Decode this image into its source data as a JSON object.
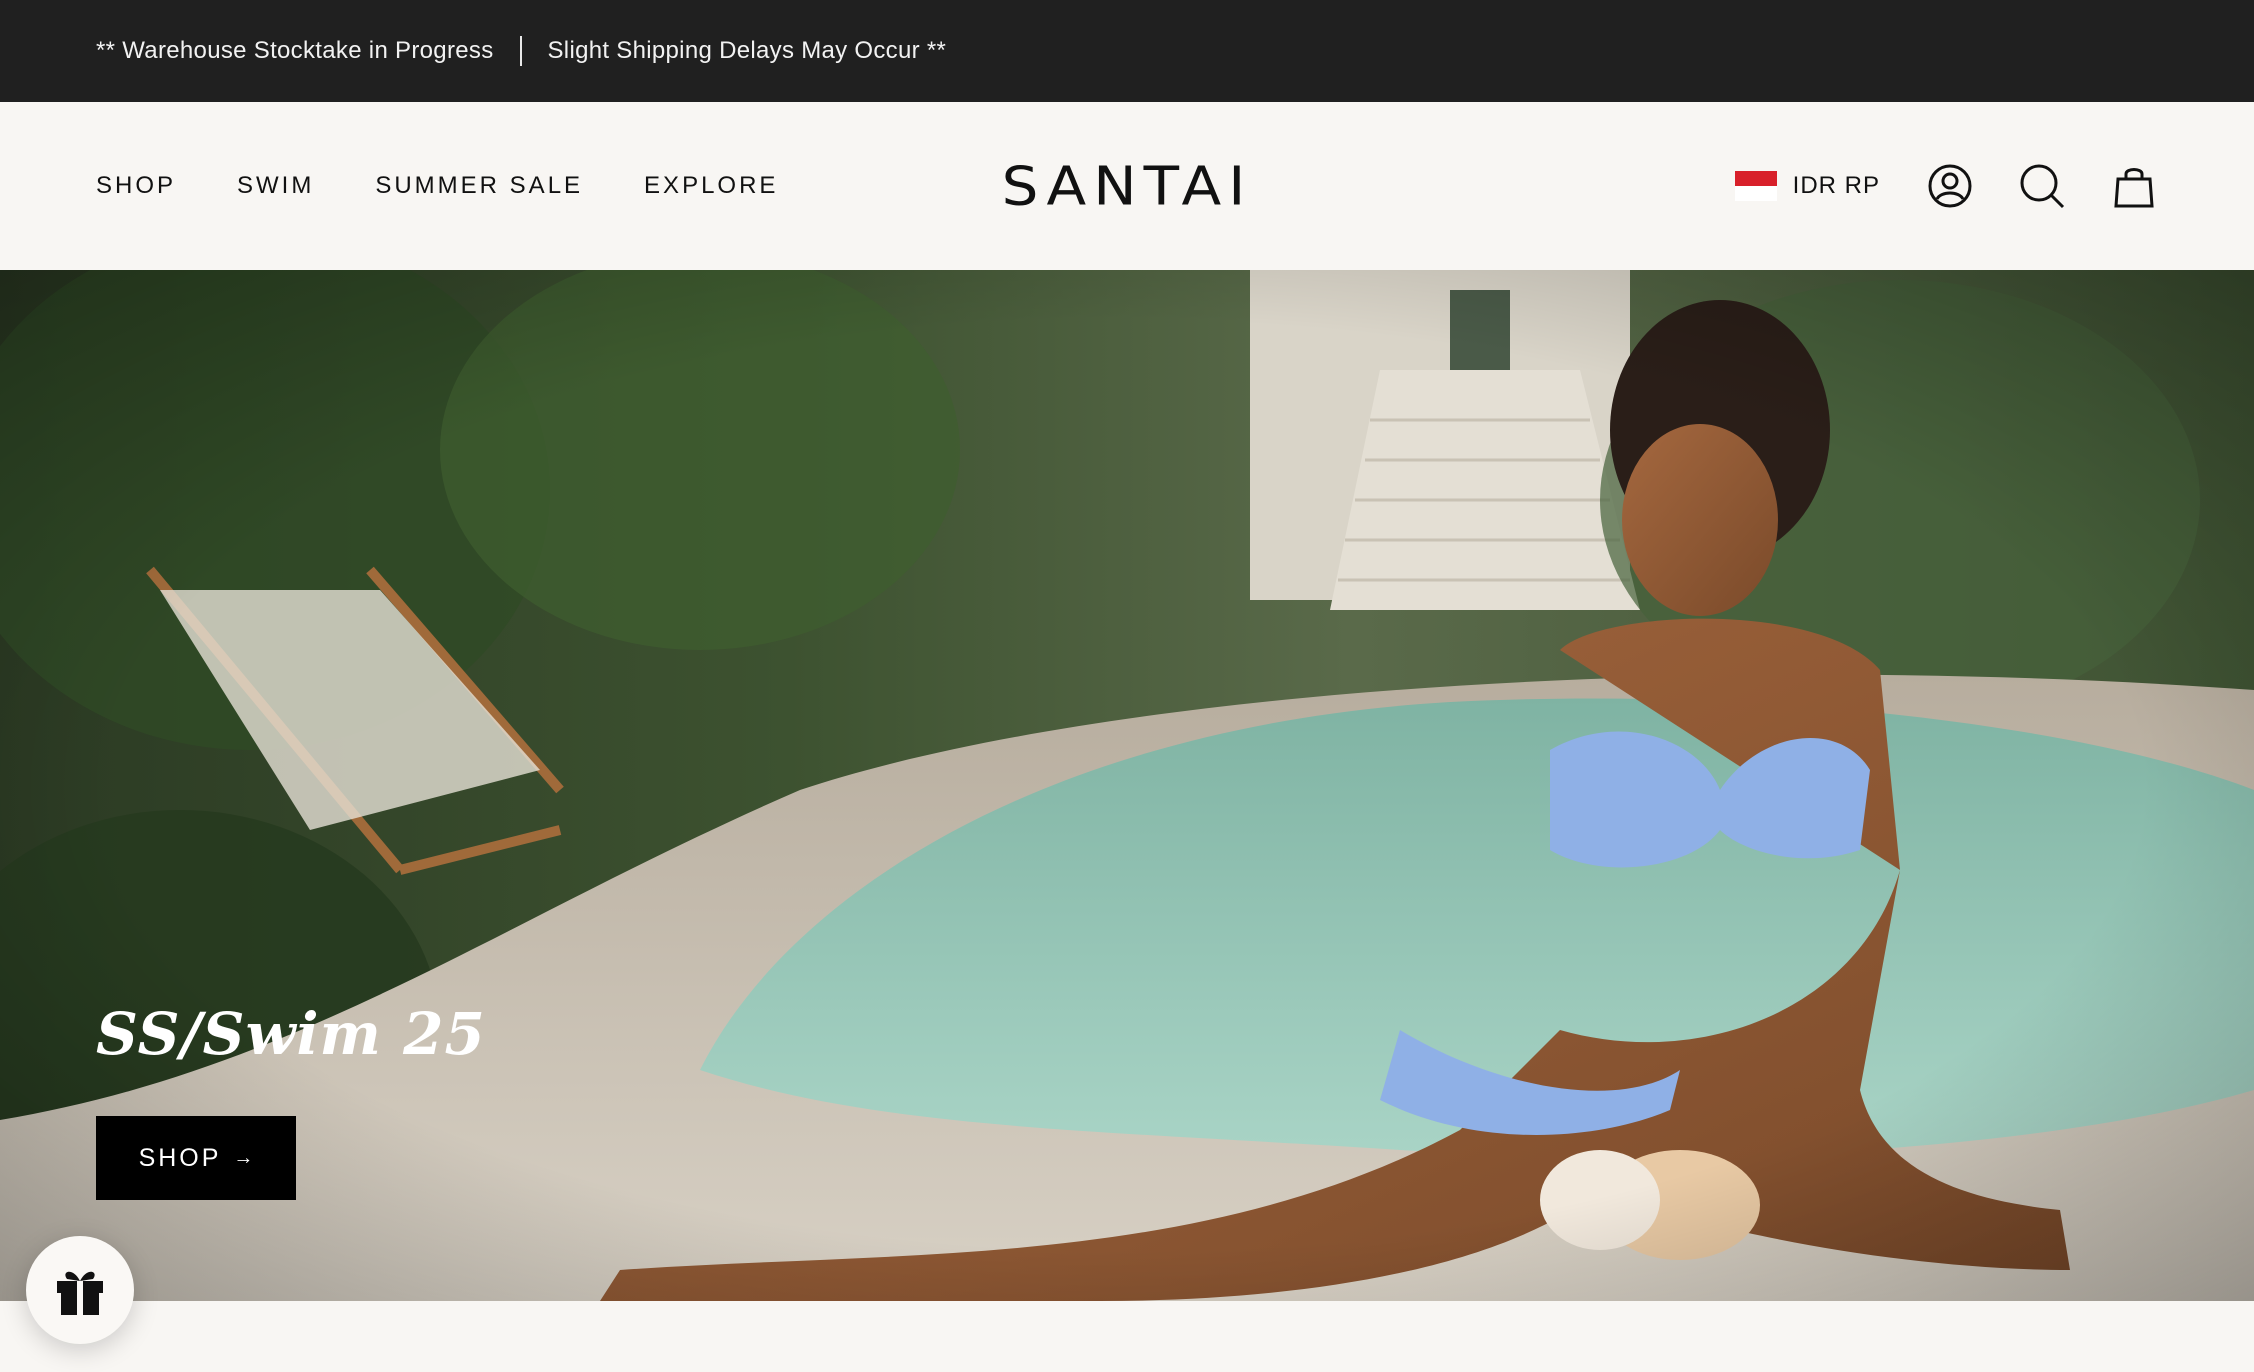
{
  "announcement": {
    "left": "** Warehouse Stocktake in Progress",
    "right": "Slight Shipping Delays May Occur **"
  },
  "header": {
    "nav": [
      "SHOP",
      "SWIM",
      "SUMMER SALE",
      "EXPLORE"
    ],
    "logo": "SANTAI",
    "currency": "IDR RP",
    "icons": [
      "account-icon",
      "search-icon",
      "cart-icon"
    ]
  },
  "hero": {
    "title": "SS/Swim 25",
    "button_label": "SHOP",
    "button_arrow": "→"
  },
  "floating": {
    "icon": "gift-icon"
  },
  "colors": {
    "announcement_bg": "#202020",
    "header_bg": "#f8f6f3",
    "button_bg": "#000000",
    "flag_red": "#d8202a"
  }
}
